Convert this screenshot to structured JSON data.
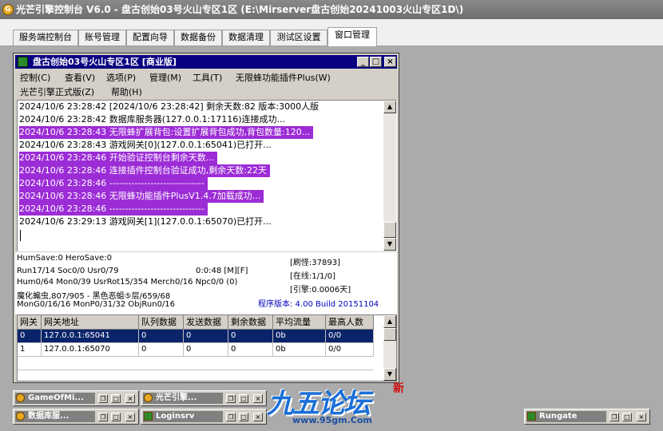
{
  "window": {
    "title": "光芒引擎控制台 V6.0 - 盘古创始03号火山专区1区 (E:\\Mirserver盘古创始20241003火山专区1D\\)"
  },
  "tabs": [
    {
      "label": "服务端控制台"
    },
    {
      "label": "账号管理"
    },
    {
      "label": "配置向导"
    },
    {
      "label": "数据备份"
    },
    {
      "label": "数据清理"
    },
    {
      "label": "测试区设置"
    },
    {
      "label": "窗口管理"
    }
  ],
  "mdi": {
    "title": "盘古创始03号火山专区1区 [商业版]",
    "menu": [
      {
        "label": "控制(C)"
      },
      {
        "label": "查看(V)"
      },
      {
        "label": "选项(P)"
      },
      {
        "label": "管理(M)"
      },
      {
        "label": "工具(T)"
      },
      {
        "label": "无限蜂功能插件Plus(W)"
      },
      {
        "label": "光芒引擎正式版(Z)"
      },
      {
        "label": "帮助(H)"
      }
    ],
    "log": [
      {
        "text": "2024/10/6 23:28:42 [2024/10/6 23:28:42] 剩余天数:82 版本:3000人版",
        "highlight": false
      },
      {
        "text": "2024/10/6 23:28:42 数据库服务器(127.0.0.1:17116)连接成功...",
        "highlight": false
      },
      {
        "text": "2024/10/6 23:28:43 无限蜂扩展背包:设置扩展背包成功,背包数量:120...",
        "highlight": true
      },
      {
        "text": "2024/10/6 23:28:43 游戏网关[0](127.0.0.1:65041)已打开...",
        "highlight": false
      },
      {
        "text": "2024/10/6 23:28:46 开始验证控制台剩余天数...",
        "highlight": true
      },
      {
        "text": "2024/10/6 23:28:46 连接插件控制台验证成功,剩余天数:22天",
        "highlight": true
      },
      {
        "text": "2024/10/6 23:28:46 ------------------------------",
        "highlight": true
      },
      {
        "text": "2024/10/6 23:28:46 无限蜂功能插件PlusV1.4.7加载成功...",
        "highlight": true
      },
      {
        "text": "2024/10/6 23:28:46 ------------------------------",
        "highlight": true
      },
      {
        "text": "2024/10/6 23:29:13 游戏网关[1](127.0.0.1:65070)已打开...",
        "highlight": false
      }
    ],
    "stats": {
      "line1": "HumSave:0 HeroSave:0",
      "line2": "Run17/14 Soc0/0 Usr0/79",
      "line2b": "0:0:48 [M][F]",
      "line3": "Hum0/64 Mon0/39 UsrRot15/354 Merch0/16 Npc0/0 (0)",
      "line4": "魔化蝙虫,807/905 - 黑色恶蛆⑤层/659/68",
      "line5": "MonG0/16/16 MonP0/31/32 ObjRun0/16",
      "brush": "[刷怪:37893]",
      "online": "[在线:1/1/0]",
      "engine": "[引擎:0.0006天]",
      "version": "程序版本: 4.00 Build 20151104"
    },
    "grid": {
      "headers": [
        "网关",
        "网关地址",
        "队列数据",
        "发送数据",
        "剩余数据",
        "平均流量",
        "最高人数"
      ],
      "rows": [
        [
          "0",
          "127.0.0.1:65041",
          "0",
          "0",
          "0",
          "0b",
          "0/0"
        ],
        [
          "1",
          "127.0.0.1:65070",
          "0",
          "0",
          "0",
          "0b",
          "0/0"
        ]
      ]
    }
  },
  "minimized": [
    {
      "title": "GameOfMi..."
    },
    {
      "title": "光芒引擎..."
    },
    {
      "title": "数据库服..."
    },
    {
      "title": "Loginsrv"
    },
    {
      "title": "Rungate"
    }
  ],
  "watermark": {
    "brand": "九五论坛",
    "url": "www.95gm.Com",
    "badge": "新"
  },
  "colors": {
    "highlight": "#9c2cd6",
    "mdi_title": "#080080",
    "selection": "#0a246a",
    "version_text": "#0000c0"
  }
}
